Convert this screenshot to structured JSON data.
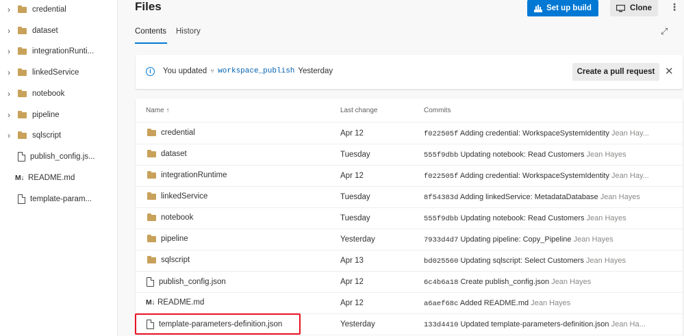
{
  "sidebar": {
    "items": [
      {
        "label": "credential",
        "kind": "folder",
        "expandable": true
      },
      {
        "label": "dataset",
        "kind": "folder",
        "expandable": true
      },
      {
        "label": "integrationRunti...",
        "kind": "folder",
        "expandable": true
      },
      {
        "label": "linkedService",
        "kind": "folder",
        "expandable": true
      },
      {
        "label": "notebook",
        "kind": "folder",
        "expandable": true
      },
      {
        "label": "pipeline",
        "kind": "folder",
        "expandable": true
      },
      {
        "label": "sqlscript",
        "kind": "folder",
        "expandable": true
      },
      {
        "label": "publish_config.js...",
        "kind": "file",
        "expandable": false
      },
      {
        "label": "README.md",
        "kind": "markdown",
        "expandable": false
      },
      {
        "label": "template-param...",
        "kind": "file",
        "expandable": false
      }
    ]
  },
  "header": {
    "title": "Files",
    "setup_build_label": "Set up build",
    "clone_label": "Clone"
  },
  "tabs": {
    "contents": "Contents",
    "history": "History",
    "active": "Contents"
  },
  "banner": {
    "prefix": "You updated",
    "branch": "workspace_publish",
    "suffix": "Yesterday",
    "pr_button": "Create a pull request"
  },
  "table": {
    "headers": {
      "name": "Name ↑",
      "last_change": "Last change",
      "commits": "Commits"
    },
    "rows": [
      {
        "name": "credential",
        "kind": "folder",
        "last_change": "Apr 12",
        "sha": "f022505f",
        "message": "Adding credential: WorkspaceSystemIdentity",
        "author": "Jean Hay..."
      },
      {
        "name": "dataset",
        "kind": "folder",
        "last_change": "Tuesday",
        "sha": "555f9dbb",
        "message": "Updating notebook: Read Customers",
        "author": "Jean Hayes"
      },
      {
        "name": "integrationRuntime",
        "kind": "folder",
        "last_change": "Apr 12",
        "sha": "f022505f",
        "message": "Adding credential: WorkspaceSystemIdentity",
        "author": "Jean Hay..."
      },
      {
        "name": "linkedService",
        "kind": "folder",
        "last_change": "Tuesday",
        "sha": "8f54383d",
        "message": "Adding linkedService: MetadataDatabase",
        "author": "Jean Hayes"
      },
      {
        "name": "notebook",
        "kind": "folder",
        "last_change": "Tuesday",
        "sha": "555f9dbb",
        "message": "Updating notebook: Read Customers",
        "author": "Jean Hayes"
      },
      {
        "name": "pipeline",
        "kind": "folder",
        "last_change": "Yesterday",
        "sha": "7933d4d7",
        "message": "Updating pipeline: Copy_Pipeline",
        "author": "Jean Hayes"
      },
      {
        "name": "sqlscript",
        "kind": "folder",
        "last_change": "Apr 13",
        "sha": "bd025560",
        "message": "Updating sqlscript: Select Customers",
        "author": "Jean Hayes"
      },
      {
        "name": "publish_config.json",
        "kind": "file",
        "last_change": "Apr 12",
        "sha": "6c4b6a18",
        "message": "Create publish_config.json",
        "author": "Jean Hayes"
      },
      {
        "name": "README.md",
        "kind": "markdown",
        "last_change": "Apr 12",
        "sha": "a6aef68c",
        "message": "Added README.md",
        "author": "Jean Hayes"
      },
      {
        "name": "template-parameters-definition.json",
        "kind": "file",
        "last_change": "Yesterday",
        "sha": "133d4410",
        "message": "Updated template-parameters-definition.json",
        "author": "Jean Ha..."
      }
    ]
  },
  "icons": {
    "chevron": "chevron-right-icon",
    "folder": "folder-icon",
    "file": "file-icon",
    "markdown": "markdown-icon",
    "info": "info-icon",
    "branch": "branch-icon",
    "close": "close-icon",
    "expand": "expand-icon",
    "more": "more-icon",
    "build": "build-icon",
    "clone": "clone-icon"
  },
  "markdown_glyph": "M↓",
  "colors": {
    "accent": "#0078d4",
    "folder": "#c8a15a",
    "highlight": "#e81123"
  }
}
